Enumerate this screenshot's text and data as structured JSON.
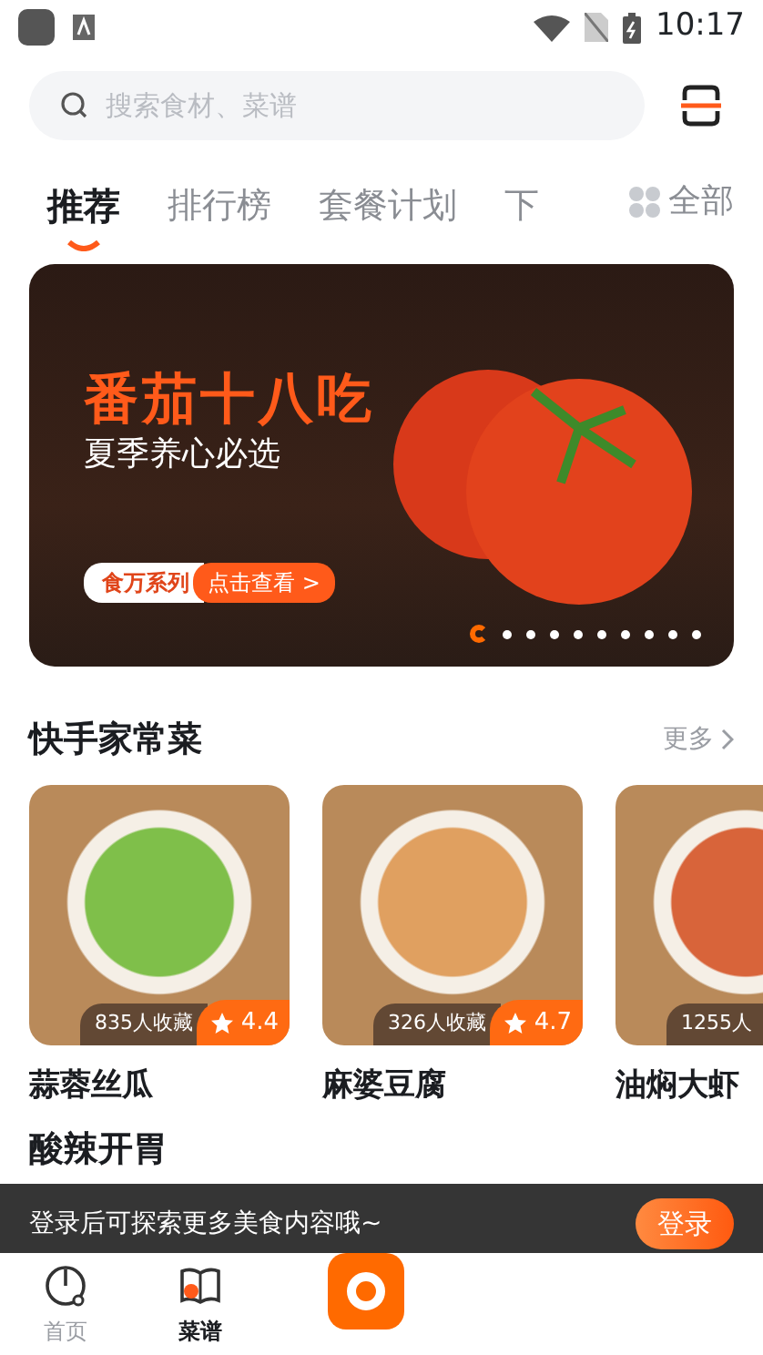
{
  "status_bar": {
    "time": "10:17"
  },
  "search": {
    "placeholder": "搜索食材、菜谱"
  },
  "tabs": [
    {
      "label": "推荐",
      "selected": true
    },
    {
      "label": "排行榜",
      "selected": false
    },
    {
      "label": "套餐计划",
      "selected": false
    },
    {
      "label": "下",
      "selected": false
    }
  ],
  "all_button": {
    "label": "全部"
  },
  "banner": {
    "title": "番茄十八吃",
    "subtitle": "夏季养心必选",
    "series_label": "食万系列",
    "action": "点击查看 >",
    "indicators": [
      {
        "selected": true
      },
      {
        "selected": false
      },
      {
        "selected": false
      },
      {
        "selected": false
      },
      {
        "selected": false
      },
      {
        "selected": false
      },
      {
        "selected": false
      },
      {
        "selected": false
      },
      {
        "selected": false
      },
      {
        "selected": false
      }
    ]
  },
  "sections": [
    {
      "title": "快手家常菜",
      "more": "更多",
      "recipes": [
        {
          "name": "蒜蓉丝瓜",
          "saves": "835人收藏",
          "rating": "4.4"
        },
        {
          "name": "麻婆豆腐",
          "saves": "326人收藏",
          "rating": "4.7"
        },
        {
          "name": "油焖大虾",
          "saves": "1255人"
        }
      ]
    },
    {
      "title": "酸辣开胃"
    }
  ],
  "login_prompt": {
    "text": "登录后可探索更多美食内容哦~",
    "button": "登录"
  },
  "bottom_nav": [
    {
      "label": "首页",
      "kind": "home",
      "selected": false
    },
    {
      "label": "菜谱",
      "kind": "recipes",
      "selected": true
    },
    {
      "kind": "center",
      "selected": false
    }
  ]
}
